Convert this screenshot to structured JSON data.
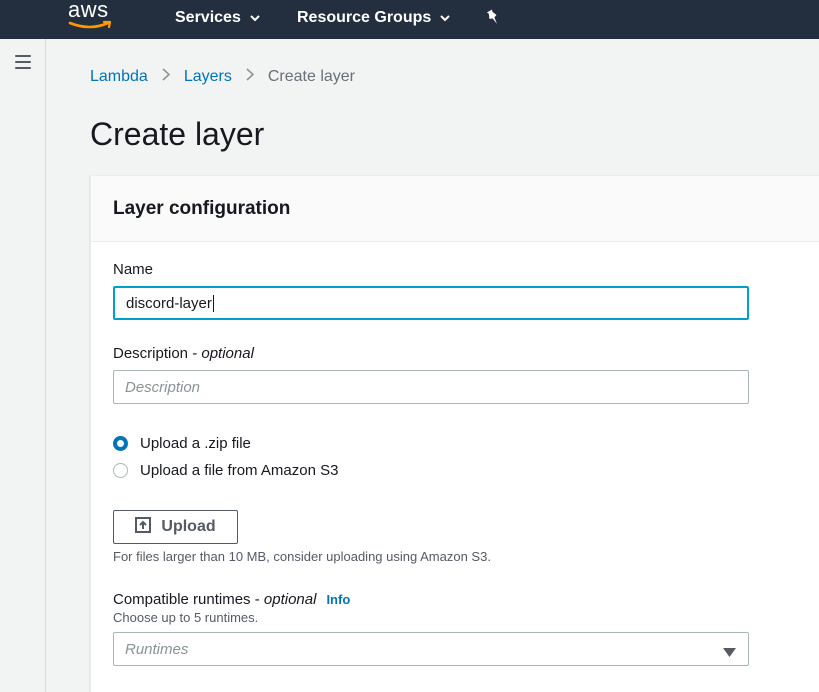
{
  "topnav": {
    "logo_text": "aws",
    "services_label": "Services",
    "resource_groups_label": "Resource Groups",
    "pin_icon": "pin-icon",
    "bg_color": "#232f3e"
  },
  "leftrail": {
    "menu_icon": "hamburger-menu-icon"
  },
  "breadcrumb": {
    "items": [
      {
        "label": "Lambda"
      },
      {
        "label": "Layers"
      },
      {
        "label": "Create layer"
      }
    ]
  },
  "page": {
    "title": "Create layer"
  },
  "panel": {
    "title": "Layer configuration",
    "name": {
      "label": "Name",
      "value": "discord-layer"
    },
    "description": {
      "label": "Description - ",
      "label_optional": "optional",
      "placeholder": "Description"
    },
    "upload_options": [
      {
        "label": "Upload a .zip file",
        "checked": true
      },
      {
        "label": "Upload a file from Amazon S3",
        "checked": false
      }
    ],
    "upload_button": {
      "label": "Upload"
    },
    "upload_hint": "For files larger than 10 MB, consider uploading using Amazon S3.",
    "runtimes": {
      "label": "Compatible runtimes - ",
      "label_optional": "optional",
      "info": "Info",
      "hint": "Choose up to 5 runtimes.",
      "placeholder": "Runtimes"
    }
  },
  "colors": {
    "accent": "#0073bb",
    "focus": "#00a1c9",
    "aws_orange": "#ff9900"
  }
}
